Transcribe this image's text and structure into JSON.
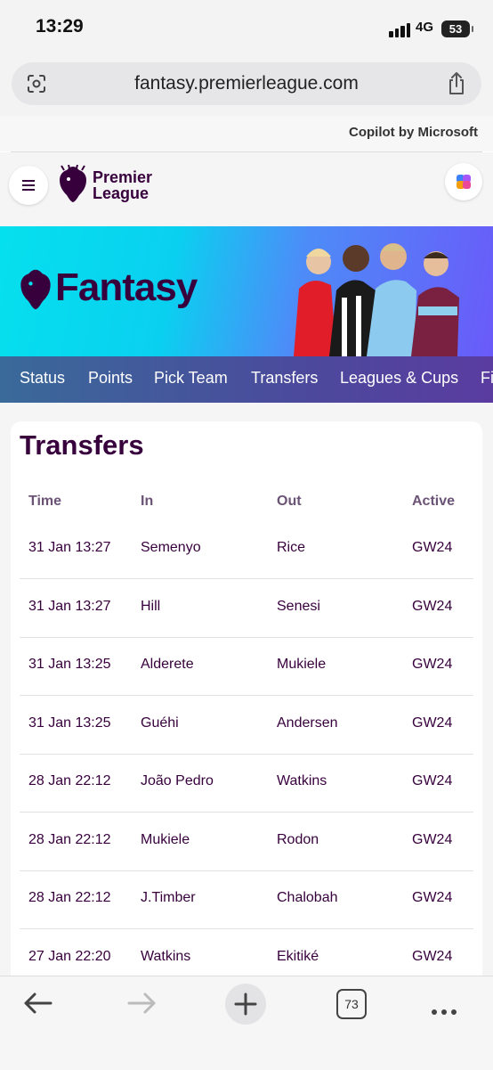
{
  "status_bar": {
    "time": "13:29",
    "network": "4G",
    "battery": "53"
  },
  "browser": {
    "url_domain": "fantasy.premierleague.com"
  },
  "copilot_strip": {
    "label": "Copilot by Microsoft"
  },
  "header": {
    "logo_line1": "Premier",
    "logo_line2": "League"
  },
  "banner": {
    "title": "Fantasy",
    "accent_colors": [
      "#05e0ee",
      "#6a5af9"
    ]
  },
  "nav": {
    "tabs": [
      "Status",
      "Points",
      "Pick Team",
      "Transfers",
      "Leagues & Cups",
      "Fi"
    ]
  },
  "transfers": {
    "title": "Transfers",
    "columns": [
      "Time",
      "In",
      "Out",
      "Active"
    ],
    "rows": [
      [
        "31 Jan 13:27",
        "Semenyo",
        "Rice",
        "GW24"
      ],
      [
        "31 Jan 13:27",
        "Hill",
        "Senesi",
        "GW24"
      ],
      [
        "31 Jan 13:25",
        "Alderete",
        "Mukiele",
        "GW24"
      ],
      [
        "31 Jan 13:25",
        "Guéhi",
        "Andersen",
        "GW24"
      ],
      [
        "28 Jan 22:12",
        "João Pedro",
        "Watkins",
        "GW24"
      ],
      [
        "28 Jan 22:12",
        "Mukiele",
        "Rodon",
        "GW24"
      ],
      [
        "28 Jan 22:12",
        "J.Timber",
        "Chalobah",
        "GW24"
      ],
      [
        "27 Jan 22:20",
        "Watkins",
        "Ekitiké",
        "GW24"
      ]
    ]
  },
  "toolbar": {
    "tab_count": "73"
  },
  "colors": {
    "brand_purple": "#37003c"
  }
}
